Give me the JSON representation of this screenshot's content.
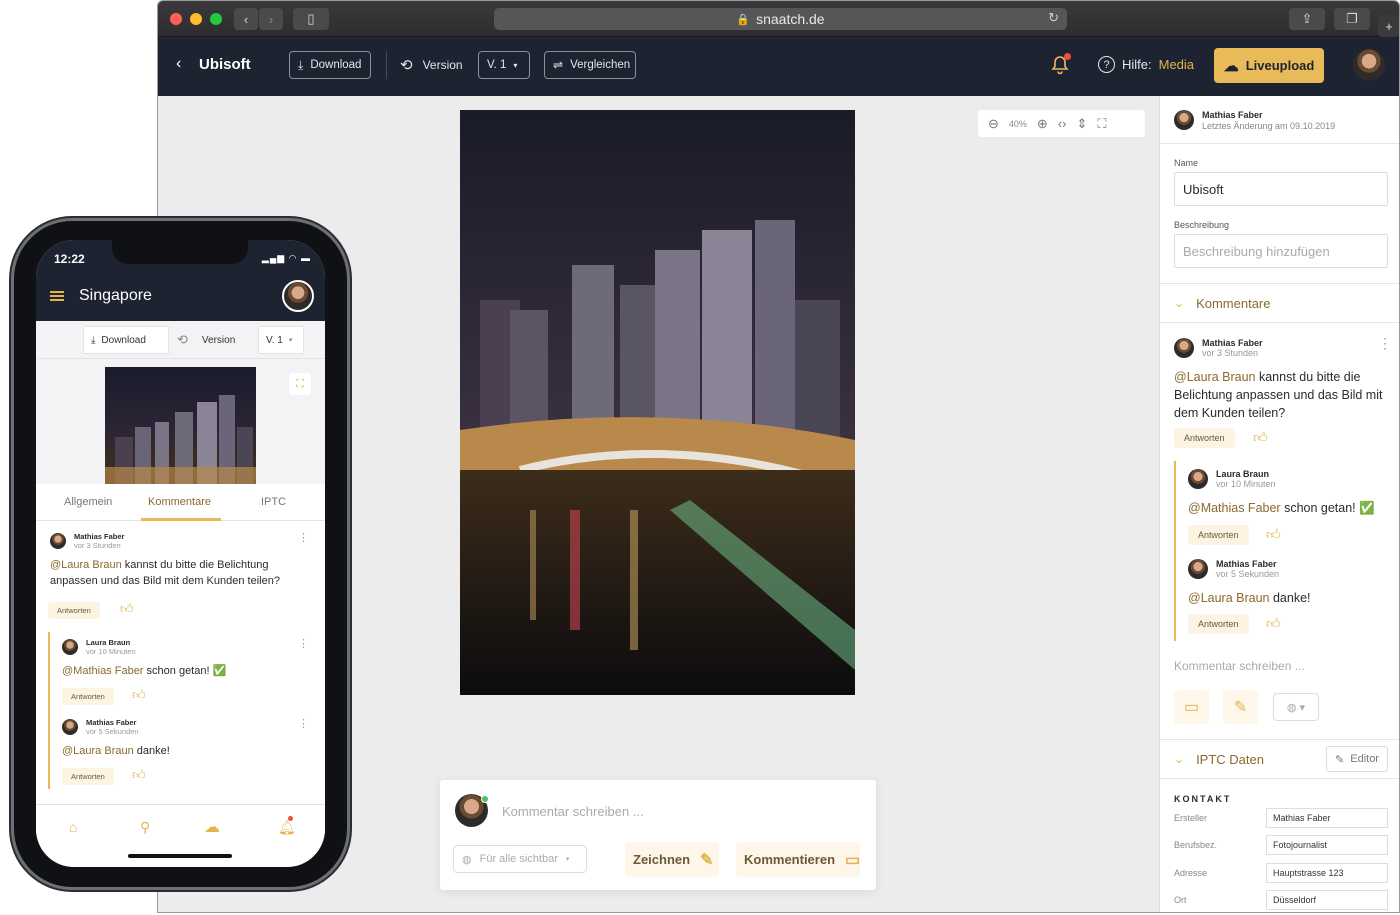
{
  "browser": {
    "url": "snaatch.de"
  },
  "app": {
    "project": "Ubisoft",
    "download_label": "Download",
    "version_label": "Version",
    "version_value": "V. 1",
    "compare_label": "Vergleichen",
    "help_prefix": "Hilfe:",
    "help_link": "Media",
    "liveupload_label": "Liveupload"
  },
  "viewer": {
    "zoom_value": "40%",
    "comment_placeholder": "Kommentar schreiben ...",
    "visibility_label": "Für alle sichtbar",
    "draw_label": "Zeichnen",
    "comment_button": "Kommentieren"
  },
  "side": {
    "author": "Mathias Faber",
    "last_change": "Letztes Änderung am 09.10.2019",
    "name_label": "Name",
    "name_value": "Ubisoft",
    "desc_label": "Beschreibung",
    "desc_placeholder": "Beschreibung hinzufügen",
    "comments_header": "Kommentare",
    "comments": [
      {
        "author": "Mathias Faber",
        "time": "vor 3 Stunden",
        "mention": "@Laura Braun",
        "text": " kannst du bitte die Belichtung anpassen und das Bild mit dem Kunden teilen?",
        "reply": "Antworten"
      },
      {
        "author": "Laura Braun",
        "time": "vor 10 Minuten",
        "mention": "@Mathias Faber",
        "text": " schon getan! ✅",
        "reply": "Antworten"
      },
      {
        "author": "Mathias Faber",
        "time": "vor 5 Sekunden",
        "mention": "@Laura Braun",
        "text": " danke!",
        "reply": "Antworten"
      }
    ],
    "write_placeholder": "Kommentar schreiben ...",
    "iptc_header": "IPTC Daten",
    "editor_label": "Editor",
    "kontakt_label": "KONTAKT",
    "kontakt": [
      {
        "key": "Ersteller",
        "value": "Mathias Faber"
      },
      {
        "key": "Berufsbez.",
        "value": "Fotojournalist"
      },
      {
        "key": "Adresse",
        "value": "Hauptstrasse 123"
      },
      {
        "key": "Ort",
        "value": "Düsseldorf"
      }
    ]
  },
  "phone": {
    "time": "12:22",
    "title": "Singapore",
    "download_label": "Download",
    "version_label": "Version",
    "version_value": "V. 1",
    "tabs": [
      "Allgemein",
      "Kommentare",
      "IPTC"
    ],
    "comments": [
      {
        "author": "Mathias Faber",
        "time": "vor 3 Stunden",
        "mention": "@Laura Braun",
        "text": " kannst du bitte die Belichtung anpassen und das Bild mit dem Kunden teilen?",
        "reply": "Antworten"
      },
      {
        "author": "Laura Braun",
        "time": "vor 10 Minuten",
        "mention": "@Mathias Faber",
        "text": " schon getan! ✅",
        "reply": "Antworten"
      },
      {
        "author": "Mathias Faber",
        "time": "vor 5 Sekunden",
        "mention": "@Laura Braun",
        "text": " danke!",
        "reply": "Antworten"
      }
    ]
  },
  "colors": {
    "accent": "#e8bb58",
    "navy": "#1d2331",
    "mention": "#8a6a2e"
  }
}
